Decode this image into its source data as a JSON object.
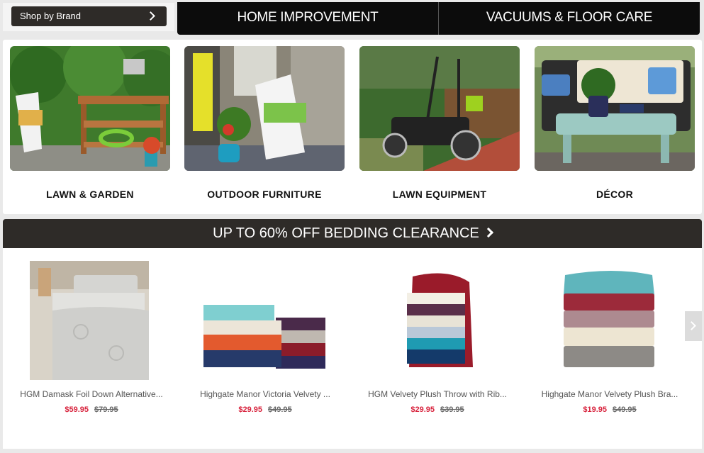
{
  "nav": {
    "shop_by_brand": "Shop by Brand",
    "tabs": [
      "HOME IMPROVEMENT",
      "VACUUMS & FLOOR CARE"
    ]
  },
  "categories": [
    {
      "label": "LAWN & GARDEN"
    },
    {
      "label": "OUTDOOR FURNITURE"
    },
    {
      "label": "LAWN EQUIPMENT"
    },
    {
      "label": "DÉCOR"
    }
  ],
  "promo": {
    "title": "UP TO 60% OFF BEDDING CLEARANCE"
  },
  "products": [
    {
      "name": "HGM Damask Foil Down Alternative...",
      "price": "$59.95",
      "original_price": "$79.95"
    },
    {
      "name": "Highgate Manor Victoria Velvety ...",
      "price": "$29.95",
      "original_price": "$49.95"
    },
    {
      "name": "HGM Velvety Plush Throw with Rib...",
      "price": "$29.95",
      "original_price": "$39.95"
    },
    {
      "name": "Highgate Manor Velvety Plush Bra...",
      "price": "$19.95",
      "original_price": "$49.95"
    }
  ],
  "colors": {
    "sale": "#d8233d",
    "header_dark": "#2e2b28",
    "nav_dark": "#0c0c0c"
  },
  "icons": {
    "chevron": "chevron-right-icon"
  }
}
